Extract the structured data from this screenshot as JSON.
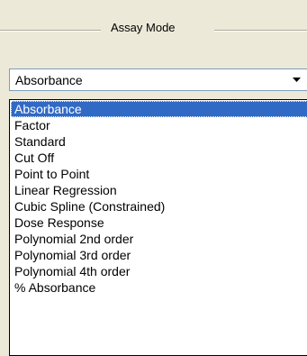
{
  "groupbox": {
    "title": "Assay Mode"
  },
  "combo": {
    "selected_value": "Absorbance"
  },
  "dropdown": {
    "items": [
      "Absorbance",
      "Factor",
      "Standard",
      "Cut Off",
      "Point to Point",
      "Linear Regression",
      "Cubic Spline (Constrained)",
      "Dose Response",
      "Polynomial 2nd order",
      "Polynomial 3rd order",
      "Polynomial 4th order",
      "% Absorbance"
    ],
    "highlighted_item": "Absorbance"
  },
  "colors": {
    "selection": "#316ac5",
    "window_background": "#ece9d8",
    "combo_border": "#7f9db9"
  },
  "icons": {
    "dropdown_arrow": "chevron-down-icon"
  }
}
